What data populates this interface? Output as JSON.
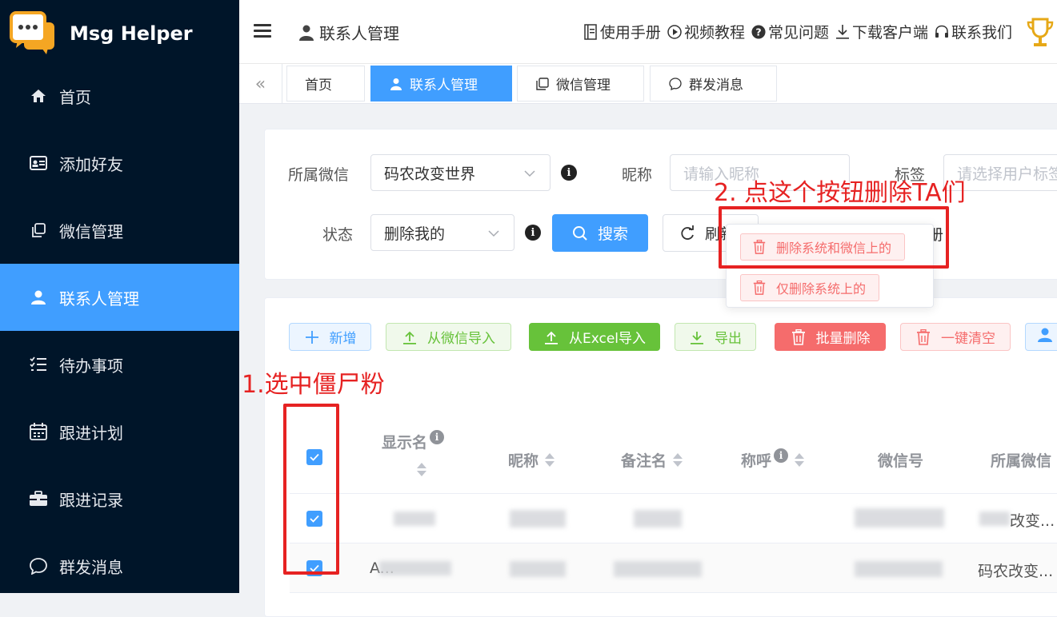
{
  "app": {
    "title": "Msg Helper"
  },
  "sidebar": {
    "items": [
      {
        "label": "首页",
        "icon": "home-icon"
      },
      {
        "label": "添加好友",
        "icon": "id-card-icon"
      },
      {
        "label": "微信管理",
        "icon": "copy-icon"
      },
      {
        "label": "联系人管理",
        "icon": "user-icon",
        "active": true
      },
      {
        "label": "待办事项",
        "icon": "checklist-icon"
      },
      {
        "label": "跟进计划",
        "icon": "calendar-icon"
      },
      {
        "label": "跟进记录",
        "icon": "briefcase-icon"
      },
      {
        "label": "群发消息",
        "icon": "chat-icon"
      }
    ]
  },
  "header": {
    "breadcrumb": "联系人管理",
    "links": [
      {
        "label": "使用手册",
        "icon": "book-icon"
      },
      {
        "label": "视频教程",
        "icon": "play-icon"
      },
      {
        "label": "常见问题",
        "icon": "question-icon"
      },
      {
        "label": "下载客户端",
        "icon": "download-icon"
      },
      {
        "label": "联系我们",
        "icon": "headset-icon"
      }
    ]
  },
  "tabs": [
    {
      "label": "首页",
      "active": false
    },
    {
      "label": "联系人管理",
      "active": true
    },
    {
      "label": "微信管理",
      "active": false
    },
    {
      "label": "群发消息",
      "active": false
    }
  ],
  "filters": {
    "wechat_label": "所属微信",
    "wechat_value": "码农改变世界",
    "nickname_label": "昵称",
    "nickname_placeholder": "请输入昵称",
    "tag_label": "标签",
    "tag_placeholder": "请选择用户标签",
    "status_label": "状态",
    "status_value": "删除我的",
    "search_btn": "搜索",
    "refresh_btn": "刷新",
    "hidden_btn_partial": "册"
  },
  "dropdown": {
    "items": [
      "删除系统和微信上的",
      "仅删除系统上的"
    ]
  },
  "toolbar": {
    "add": "新增",
    "import_wechat": "从微信导入",
    "import_excel": "从Excel导入",
    "export": "导出",
    "batch_delete": "批量删除",
    "clear_all": "一键清空"
  },
  "table": {
    "columns": [
      "显示名",
      "昵称",
      "备注名",
      "称呼",
      "微信号",
      "所属微信"
    ],
    "rows": [
      {
        "display": "",
        "wechat_owner": "改变..."
      },
      {
        "display": "A...",
        "wechat_owner": "码农改变..."
      }
    ]
  },
  "annotations": {
    "step1": "1.选中僵尸粉",
    "step2": "2. 点这个按钮删除TA们"
  },
  "colors": {
    "sidebar_bg": "#001529",
    "primary": "#409eff",
    "danger": "#f56c6c",
    "success": "#67c23a",
    "annotation": "#e62222"
  }
}
